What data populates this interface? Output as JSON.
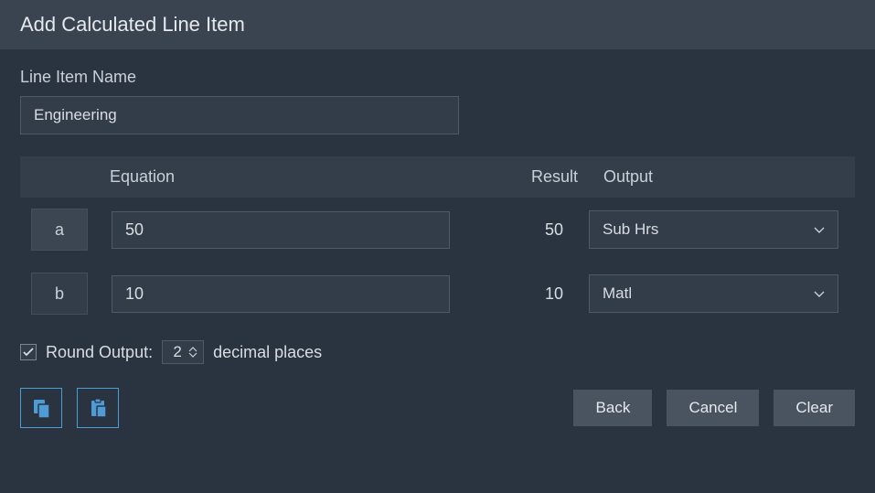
{
  "header": {
    "title": "Add Calculated Line Item"
  },
  "lineItem": {
    "label": "Line Item Name",
    "value": "Engineering"
  },
  "columns": {
    "equation": "Equation",
    "result": "Result",
    "output": "Output"
  },
  "rows": [
    {
      "var": "a",
      "equation": "50",
      "result": "50",
      "output": "Sub Hrs"
    },
    {
      "var": "b",
      "equation": "10",
      "result": "10",
      "output": "Matl"
    }
  ],
  "round": {
    "checked": true,
    "label": "Round Output:",
    "value": "2",
    "suffix": "decimal places"
  },
  "buttons": {
    "back": "Back",
    "cancel": "Cancel",
    "clear": "Clear"
  }
}
